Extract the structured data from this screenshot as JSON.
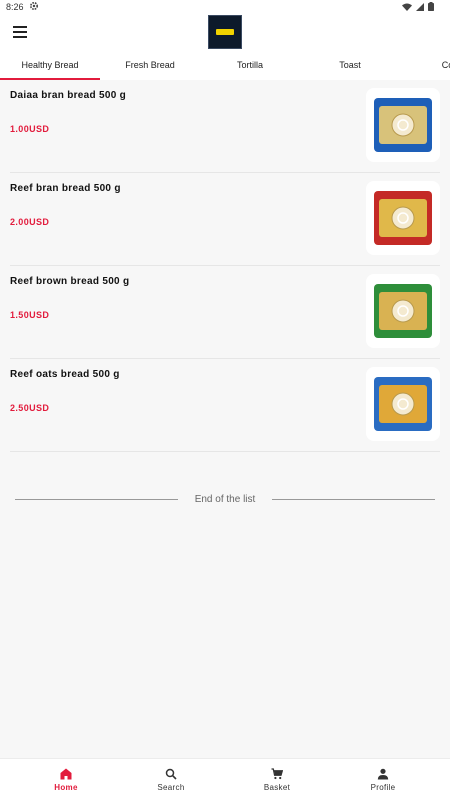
{
  "status_bar": {
    "time": "8:26"
  },
  "tabs": [
    {
      "label": "Healthy Bread",
      "active": true
    },
    {
      "label": "Fresh Bread",
      "active": false
    },
    {
      "label": "Tortilla",
      "active": false
    },
    {
      "label": "Toast",
      "active": false
    },
    {
      "label": "Coo",
      "active": false
    }
  ],
  "products": [
    {
      "name": "Daiaa bran bread 500 g",
      "price": "1.00USD",
      "pack_color": "#1e5fb8",
      "label_color": "#d8c27a"
    },
    {
      "name": "Reef bran bread 500 g",
      "price": "2.00USD",
      "pack_color": "#c42a26",
      "label_color": "#e0b84a"
    },
    {
      "name": "Reef brown bread 500 g",
      "price": "1.50USD",
      "pack_color": "#2e8e3a",
      "label_color": "#d9b252"
    },
    {
      "name": "Reef oats bread 500 g",
      "price": "2.50USD",
      "pack_color": "#2a6cc2",
      "label_color": "#e0a838"
    }
  ],
  "end_of_list": "End of the list",
  "bottom_nav": [
    {
      "label": "Home",
      "icon": "home-icon",
      "active": true
    },
    {
      "label": "Search",
      "icon": "search-icon",
      "active": false
    },
    {
      "label": "Basket",
      "icon": "cart-icon",
      "active": false
    },
    {
      "label": "Profile",
      "icon": "person-icon",
      "active": false
    }
  ],
  "colors": {
    "accent": "#e21b3c",
    "logo_bg": "#0d1a2b",
    "logo_mark": "#f1d200"
  }
}
